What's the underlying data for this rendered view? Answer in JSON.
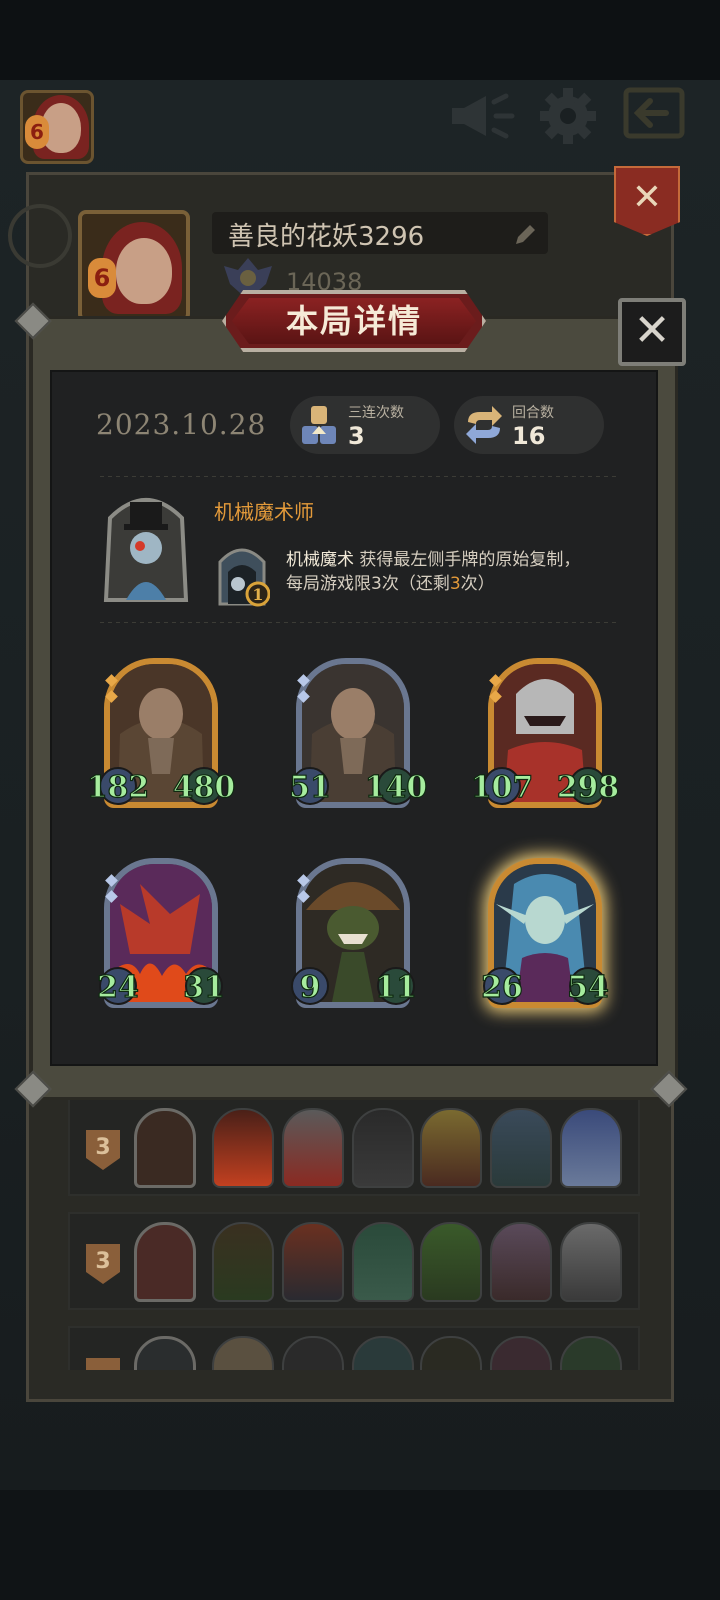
{
  "top_bar": {
    "avatar_level": "6",
    "icons": [
      "megaphone-icon",
      "gear-icon",
      "exit-icon"
    ]
  },
  "profile": {
    "name": "善良的花妖3296",
    "score": "14038",
    "avatar_level": "6"
  },
  "modal": {
    "title": "本局详情",
    "date": "2023.10.28",
    "triple": {
      "label": "三连次数",
      "value": "3"
    },
    "rounds": {
      "label": "回合数",
      "value": "16"
    },
    "hero": {
      "name": "机械魔术师",
      "skill_level": "1",
      "skill_name": "机械魔术",
      "skill_text_1": " 获得最左侧手牌的原始复制，",
      "skill_text_2": "每局游戏限3次（还剩",
      "skill_remaining": "3",
      "skill_text_3": "次）"
    },
    "cards": [
      {
        "attack": "182",
        "health": "480",
        "frame": "gold",
        "tier_gems": 2
      },
      {
        "attack": "51",
        "health": "140",
        "frame": "silver",
        "tier_gems": 2
      },
      {
        "attack": "107",
        "health": "298",
        "frame": "gold",
        "tier_gems": 2
      },
      {
        "attack": "24",
        "health": "31",
        "frame": "silver",
        "tier_gems": 2
      },
      {
        "attack": "9",
        "health": "11",
        "frame": "silver",
        "tier_gems": 2
      },
      {
        "attack": "26",
        "health": "54",
        "frame": "gold",
        "tier_gems": 0
      }
    ]
  },
  "history": [
    {
      "rank": "3"
    },
    {
      "rank": "3"
    },
    {
      "rank": ""
    }
  ],
  "colors": {
    "accent_orange": "#e39a3a",
    "stat_green": "#9ee3a0",
    "banner_red": "#8b2222",
    "gold_frame": "#c98a32",
    "silver_frame": "#6a7790"
  }
}
